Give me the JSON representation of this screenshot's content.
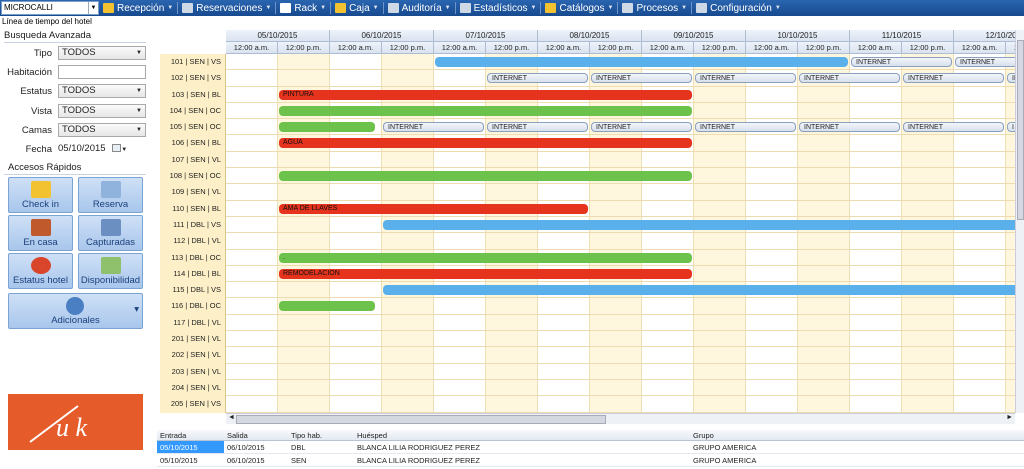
{
  "app": {
    "hotel_selector": "MICROCALLI",
    "subtitle": "Línea de tiempo del hotel"
  },
  "menu": [
    {
      "label": "Recepción",
      "icon": "bell-icon",
      "color": "#f2c230"
    },
    {
      "label": "Reservaciones",
      "icon": "calendar-icon",
      "color": "#cfd9e6"
    },
    {
      "label": "Rack",
      "icon": "grid-icon",
      "color": "#ffffff"
    },
    {
      "label": "Caja",
      "icon": "cash-icon",
      "color": "#f2c230"
    },
    {
      "label": "Auditoría",
      "icon": "audit-icon",
      "color": "#cfd9e6"
    },
    {
      "label": "Estadísticos",
      "icon": "chart-icon",
      "color": "#cfd9e6"
    },
    {
      "label": "Catálogos",
      "icon": "catalog-icon",
      "color": "#f2c230"
    },
    {
      "label": "Procesos",
      "icon": "process-icon",
      "color": "#cfd9e6"
    },
    {
      "label": "Configuración",
      "icon": "gear-icon",
      "color": "#cfd9e6"
    }
  ],
  "search": {
    "title": "Busqueda Avanzada",
    "tipo_label": "Tipo",
    "tipo_value": "TODOS",
    "habitacion_label": "Habitación",
    "habitacion_value": "",
    "estatus_label": "Estatus",
    "estatus_value": "TODOS",
    "vista_label": "Vista",
    "vista_value": "TODOS",
    "camas_label": "Camas",
    "camas_value": "TODOS",
    "fecha_label": "Fecha",
    "fecha_value": "05/10/2015"
  },
  "quick": {
    "title": "Accesos Rápidos",
    "buttons": [
      {
        "label": "Check in",
        "icon": "key-icon"
      },
      {
        "label": "Reserva",
        "icon": "calendar-reserve-icon"
      },
      {
        "label": "En casa",
        "icon": "house-icon"
      },
      {
        "label": "Capturadas",
        "icon": "list-icon"
      },
      {
        "label": "Estatus hotel",
        "icon": "pie-chart-icon"
      },
      {
        "label": "Disponibilidad",
        "icon": "availability-icon"
      },
      {
        "label": "Adicionales",
        "icon": "info-icon"
      }
    ]
  },
  "logo": {
    "text": "u k",
    "color": "#e55c2a"
  },
  "timeline": {
    "dates": [
      "05/10/2015",
      "06/10/2015",
      "07/10/2015",
      "08/10/2015",
      "09/10/2015",
      "10/10/2015",
      "11/10/2015",
      "12/10/2015"
    ],
    "time_labels": [
      "12:00 a.m.",
      "12:00 p.m."
    ],
    "rooms": [
      {
        "label": "101 | SEN | VS",
        "bars": [
          {
            "type": "blue",
            "s": 4,
            "e": 12
          },
          {
            "type": "net",
            "s": 12,
            "e": 14,
            "text": "INTERNET"
          },
          {
            "type": "net",
            "s": 14,
            "e": 16,
            "text": "INTERNET"
          },
          {
            "type": "net",
            "s": 16,
            "e": 16.3,
            "text": "I"
          }
        ]
      },
      {
        "label": "102 | SEN | VS",
        "bars": [
          {
            "type": "net",
            "s": 5,
            "e": 7,
            "text": "INTERNET"
          },
          {
            "type": "net",
            "s": 7,
            "e": 9,
            "text": "INTERNET"
          },
          {
            "type": "net",
            "s": 9,
            "e": 11,
            "text": "INTERNET"
          },
          {
            "type": "net",
            "s": 11,
            "e": 13,
            "text": "INTERNET"
          },
          {
            "type": "net",
            "s": 13,
            "e": 15,
            "text": "INTERNET"
          },
          {
            "type": "net",
            "s": 15,
            "e": 16.3,
            "text": "INTERNET"
          }
        ]
      },
      {
        "label": "103 | SEN | BL",
        "bars": [
          {
            "type": "red",
            "s": 1,
            "e": 9,
            "text": "PINTURA"
          }
        ]
      },
      {
        "label": "104 | SEN | OC",
        "bars": [
          {
            "type": "green",
            "s": 1,
            "e": 9
          }
        ]
      },
      {
        "label": "105 | SEN | OC",
        "bars": [
          {
            "type": "green",
            "s": 1,
            "e": 2.9
          },
          {
            "type": "net",
            "s": 3,
            "e": 5,
            "text": "INTERNET"
          },
          {
            "type": "net",
            "s": 5,
            "e": 7,
            "text": "INTERNET"
          },
          {
            "type": "net",
            "s": 7,
            "e": 9,
            "text": "INTERNET"
          },
          {
            "type": "net",
            "s": 9,
            "e": 11,
            "text": "INTERNET"
          },
          {
            "type": "net",
            "s": 11,
            "e": 13,
            "text": "INTERNET"
          },
          {
            "type": "net",
            "s": 13,
            "e": 15,
            "text": "INTERNET"
          },
          {
            "type": "net",
            "s": 15,
            "e": 16.3,
            "text": "I"
          }
        ]
      },
      {
        "label": "106 | SEN | BL",
        "bars": [
          {
            "type": "red",
            "s": 1,
            "e": 9,
            "text": "AGUA"
          }
        ]
      },
      {
        "label": "107 | SEN | VL",
        "bars": []
      },
      {
        "label": "108 | SEN | OC",
        "bars": [
          {
            "type": "green",
            "s": 1,
            "e": 9
          }
        ]
      },
      {
        "label": "109 | SEN | VL",
        "bars": []
      },
      {
        "label": "110 | SEN | BL",
        "bars": [
          {
            "type": "red",
            "s": 1,
            "e": 7,
            "text": "AMA DE LLAVES"
          }
        ]
      },
      {
        "label": "111 | DBL | VS",
        "bars": [
          {
            "type": "blue",
            "s": 3,
            "e": 16.3
          }
        ]
      },
      {
        "label": "112 | DBL | VL",
        "bars": []
      },
      {
        "label": "113 | DBL | OC",
        "bars": [
          {
            "type": "green",
            "s": 1,
            "e": 9,
            "text": "."
          }
        ]
      },
      {
        "label": "114 | DBL | BL",
        "bars": [
          {
            "type": "red",
            "s": 1,
            "e": 9,
            "text": "REMODELACION"
          }
        ]
      },
      {
        "label": "115 | DBL | VS",
        "bars": [
          {
            "type": "blue",
            "s": 3,
            "e": 16.3
          }
        ]
      },
      {
        "label": "116 | DBL | OC",
        "bars": [
          {
            "type": "green",
            "s": 1,
            "e": 2.9
          }
        ]
      },
      {
        "label": "117 | DBL | VL",
        "bars": []
      },
      {
        "label": "201 | SEN | VL",
        "bars": []
      },
      {
        "label": "202 | SEN | VL",
        "bars": []
      },
      {
        "label": "203 | SEN | VL",
        "bars": []
      },
      {
        "label": "204 | SEN | VL",
        "bars": []
      },
      {
        "label": "205 | SEN | VS",
        "bars": []
      }
    ]
  },
  "table": {
    "headers": [
      "Entrada",
      "Salida",
      "Tipo hab.",
      "Huésped",
      "Grupo"
    ],
    "rows": [
      [
        "05/10/2015",
        "06/10/2015",
        "DBL",
        "BLANCA LILIA RODRIGUEZ PEREZ",
        "GRUPO AMERICA"
      ],
      [
        "05/10/2015",
        "06/10/2015",
        "SEN",
        "BLANCA LILIA RODRIGUEZ PEREZ",
        "GRUPO AMERICA"
      ]
    ]
  }
}
